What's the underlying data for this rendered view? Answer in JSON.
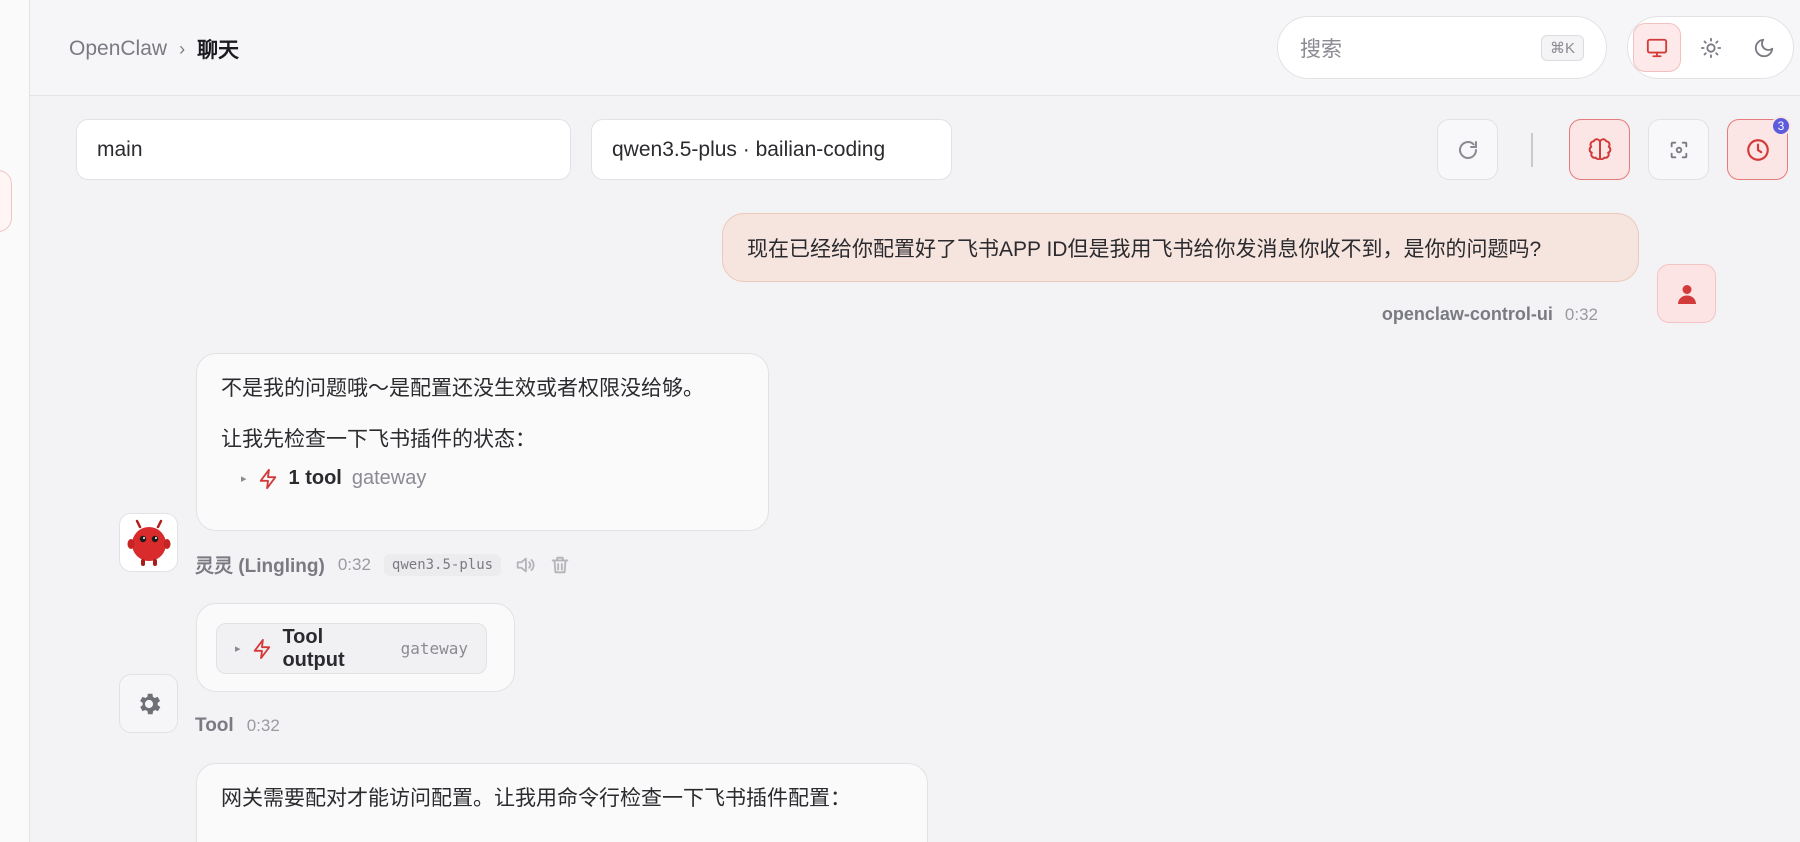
{
  "header": {
    "app_name": "OpenClaw",
    "separator": "›",
    "page_title": "聊天",
    "search_placeholder": "搜索",
    "search_shortcut": "⌘K",
    "theme_options": [
      "system",
      "light",
      "dark"
    ],
    "theme_active": "system"
  },
  "toolbar": {
    "session": "main",
    "model": "qwen3.5-plus · bailian-coding",
    "scheduled_badge": "3"
  },
  "messages": {
    "user": {
      "text": "现在已经给你配置好了飞书APP ID但是我用飞书给你发消息你收不到，是你的问题吗?",
      "sender": "openclaw-control-ui",
      "time": "0:32"
    },
    "assistant1": {
      "line1": "不是我的问题哦～是配置还没生效或者权限没给够。",
      "line2": "让我先检查一下飞书插件的状态：",
      "tool_count": "1 tool",
      "tool_name": "gateway",
      "sender": "灵灵 (Lingling)",
      "time": "0:32",
      "model": "qwen3.5-plus"
    },
    "tool_output": {
      "label": "Tool output",
      "tool_name": "gateway",
      "sender": "Tool",
      "time": "0:32"
    },
    "assistant2": {
      "line1": "网关需要配对才能访问配置。让我用命令行检查一下飞书插件配置："
    }
  },
  "colors": {
    "accent": "#d33a3a",
    "user_bubble": "#f6e5de",
    "badge": "#5b5bdc"
  }
}
